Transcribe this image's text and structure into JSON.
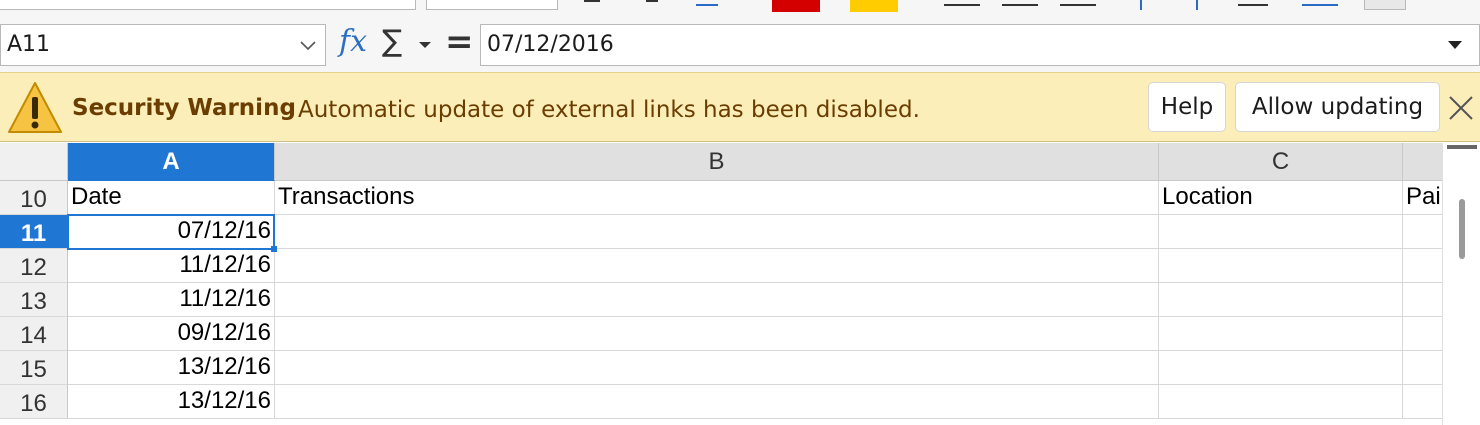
{
  "toolbar": {
    "font_color": "#d40000",
    "highlight_color": "#ffcc00"
  },
  "formula_bar": {
    "name_box": "A11",
    "fx_icon": "function-wizard-icon",
    "sum_symbol": "∑",
    "equals_symbol": "=",
    "formula_value": "07/12/2016"
  },
  "infobar": {
    "title": "Security Warning",
    "message": "Automatic update of external links has been disabled.",
    "help_label": "Help",
    "allow_label": "Allow updating",
    "accent_color": "#6b3d00"
  },
  "sheet": {
    "columns": [
      "A",
      "B",
      "C"
    ],
    "partial_column_text": "Pai",
    "active_column": "A",
    "active_row": "11",
    "rows": [
      {
        "num": "10",
        "a": "Date",
        "b": "Transactions",
        "c": "Location"
      },
      {
        "num": "11",
        "a": "07/12/16",
        "b": "",
        "c": ""
      },
      {
        "num": "12",
        "a": "11/12/16",
        "b": "",
        "c": ""
      },
      {
        "num": "13",
        "a": "11/12/16",
        "b": "",
        "c": ""
      },
      {
        "num": "14",
        "a": "09/12/16",
        "b": "",
        "c": ""
      },
      {
        "num": "15",
        "a": "13/12/16",
        "b": "",
        "c": ""
      },
      {
        "num": "16",
        "a": "13/12/16",
        "b": "",
        "c": ""
      }
    ]
  }
}
